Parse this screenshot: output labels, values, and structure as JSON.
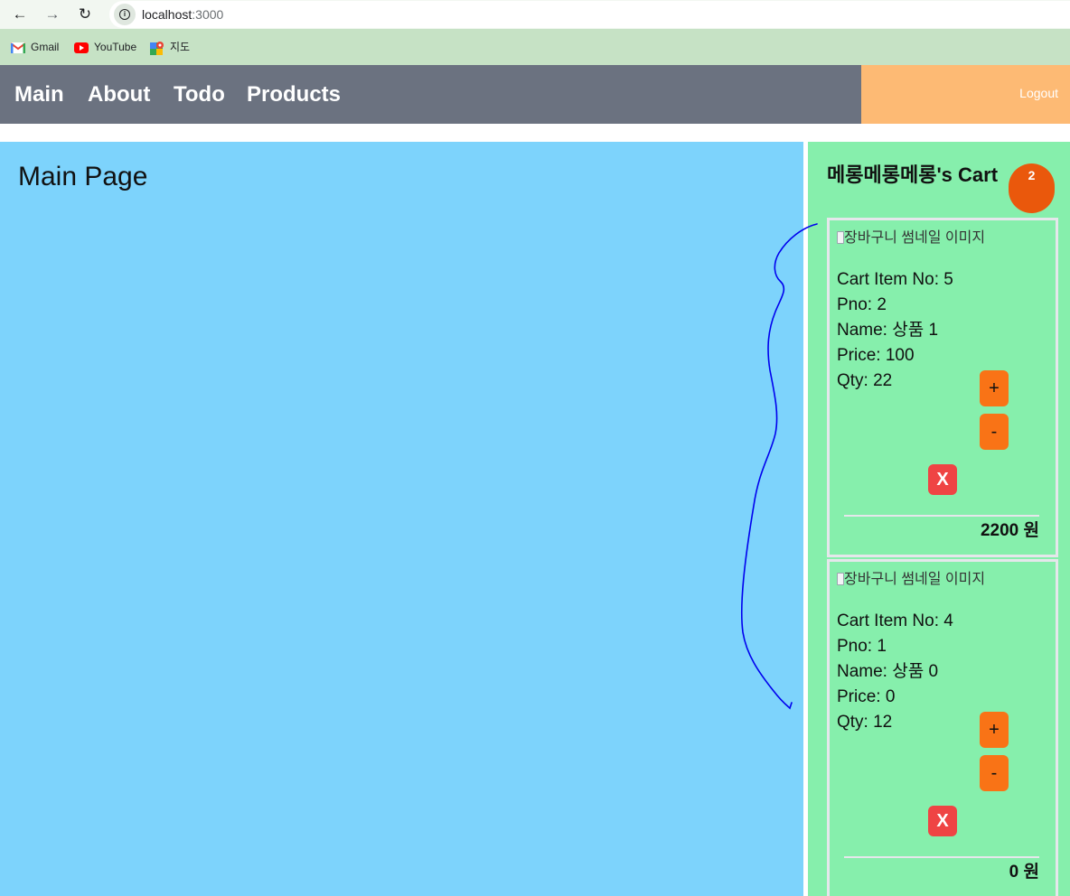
{
  "browser": {
    "back_icon": "←",
    "forward_icon": "→",
    "reload_icon": "↻",
    "url_host": "localhost",
    "url_port": ":3000",
    "bookmarks": [
      {
        "label": "Gmail",
        "icon": "gmail-icon"
      },
      {
        "label": "YouTube",
        "icon": "youtube-icon"
      },
      {
        "label": "지도",
        "icon": "maps-icon"
      }
    ]
  },
  "header": {
    "nav": [
      {
        "label": "Main"
      },
      {
        "label": "About"
      },
      {
        "label": "Todo"
      },
      {
        "label": "Products"
      }
    ],
    "logout_label": "Logout"
  },
  "main": {
    "title": "Main Page"
  },
  "cart": {
    "title": "메롱메롱메롱's Cart",
    "count": "2",
    "items": [
      {
        "thumb_alt": "장바구니 썸네일 이미지",
        "cart_item_no": "Cart Item No: 5",
        "pno": "Pno: 2",
        "name": "Name: 상품 1",
        "price": "Price: 100",
        "qty": "Qty: 22",
        "plus": "+",
        "minus": "-",
        "remove": "X",
        "total": "2200 원"
      },
      {
        "thumb_alt": "장바구니 썸네일 이미지",
        "cart_item_no": "Cart Item No: 4",
        "pno": "Pno: 1",
        "name": "Name: 상품 0",
        "price": "Price: 0",
        "qty": "Qty: 12",
        "plus": "+",
        "minus": "-",
        "remove": "X",
        "total": "0 원"
      }
    ]
  },
  "colors": {
    "nav_bg": "#6b7280",
    "logout_bg": "#fdba74",
    "main_bg": "#7dd3fc",
    "cart_bg": "#86efac",
    "badge": "#ea580c",
    "qty_button": "#f97316",
    "remove_button": "#ef4444",
    "annotation_stroke": "#0000ee"
  }
}
